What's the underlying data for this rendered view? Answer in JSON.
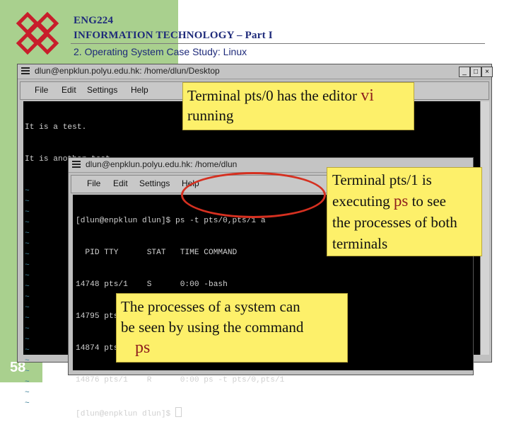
{
  "header": {
    "course": "ENG224",
    "course_title": "INFORMATION TECHNOLOGY – Part I",
    "section": "2. Operating System Case Study: Linux"
  },
  "page_number": "58",
  "logo_icon": "polyu-logo-icon",
  "colors": {
    "sidebar": "#a9d08e",
    "note": "#fdf06a",
    "highlight": "#8e1d1d",
    "circle": "#d53020",
    "terminal_bg": "#000000"
  },
  "window1": {
    "title": "dlun@enpklun.polyu.edu.hk: /home/dlun/Desktop",
    "menu": [
      "File",
      "Edit",
      "Settings",
      "Help"
    ],
    "lines": [
      "It is a test.",
      "It is another test."
    ],
    "tildes": [
      "~",
      "~",
      "~",
      "~",
      "~",
      "~",
      "~",
      "~",
      "~",
      "~",
      "~",
      "~",
      "~",
      "~",
      "~",
      "~",
      "~",
      "~",
      "~",
      "~",
      "~"
    ]
  },
  "window2": {
    "title": "dlun@enpklun.polyu.edu.hk: /home/dlun",
    "menu": [
      "File",
      "Edit",
      "Settings",
      "Help"
    ],
    "lines": [
      "[dlun@enpklun dlun]$ ps -t pts/0,pts/1 a",
      "  PID TTY      STAT   TIME COMMAND",
      "14748 pts/1    S      0:00 -bash",
      "14795 pts/0    S      0:00 -bash",
      "14874 pts/0    S      0:00 vi test1.txt",
      "14876 pts/1    R      0:00 ps -t pts/0,pts/1",
      "[dlun@enpklun dlun]$ "
    ]
  },
  "note1": {
    "text": "Terminal pts/0 has the editor",
    "highlight": "vi",
    "text2": "running"
  },
  "note2": {
    "line1": "Terminal pts/1 is",
    "line2a": "executing",
    "highlight": "ps",
    "line2b": "to see",
    "line3": "the processes of both",
    "line4": "terminals"
  },
  "note3": {
    "line1": "The processes of a system can",
    "line2": "be seen by using the command",
    "highlight": "ps"
  }
}
